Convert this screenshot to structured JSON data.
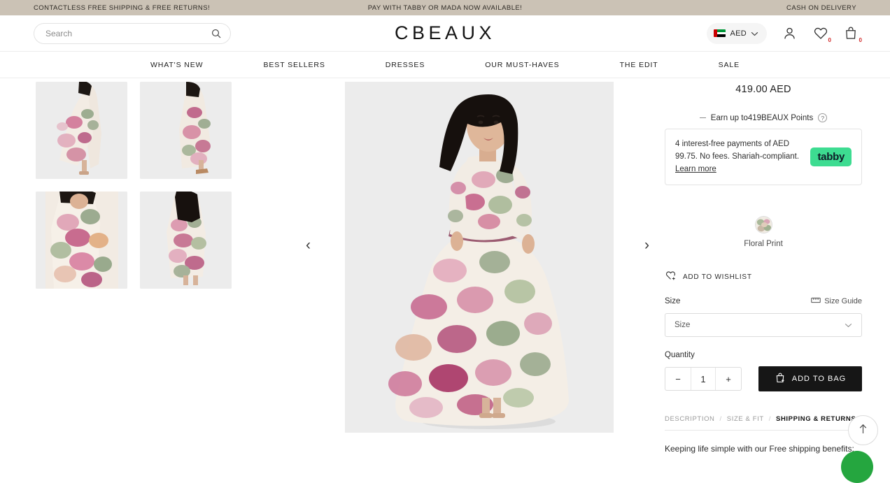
{
  "announcement": {
    "left": "CONTACTLESS FREE SHIPPING & FREE RETURNS!",
    "center": "PAY WITH TABBY OR MADA NOW AVAILABLE!",
    "right": "CASH ON DELIVERY",
    "background": "#cbc2b5"
  },
  "header": {
    "logo": "CBEAUX",
    "search_placeholder": "Search",
    "search_value": "",
    "currency": "AED",
    "wishlist_count": "0",
    "bag_count": "0"
  },
  "nav": {
    "items": [
      {
        "label": "WHAT'S NEW"
      },
      {
        "label": "BEST SELLERS"
      },
      {
        "label": "DRESSES"
      },
      {
        "label": "OUR MUST-HAVES"
      },
      {
        "label": "THE EDIT"
      },
      {
        "label": "SALE"
      }
    ]
  },
  "gallery": {
    "prev_arrow": "‹",
    "next_arrow": "›",
    "thumbnails": [
      {
        "alt": "floral maxi dress side flowing view"
      },
      {
        "alt": "floral maxi dress side profile view"
      },
      {
        "alt": "floral maxi dress bodice close-up"
      },
      {
        "alt": "floral maxi dress back view"
      }
    ],
    "hero": {
      "alt": "model wearing floral print maxi dress front view"
    }
  },
  "product": {
    "price": "419.00 AED",
    "points_text": "Earn up to419BEAUX Points",
    "points_help": "?",
    "tabby": {
      "text": "4 interest-free payments of AED 99.75. No fees. Shariah-compliant. ",
      "link": "Learn more",
      "logo": "tabby",
      "logo_color": "#3ddc91"
    },
    "color": {
      "name": "Floral Print"
    },
    "wishlist_label": "ADD TO WISHLIST",
    "size_label": "Size",
    "size_guide_label": "Size Guide",
    "size_selected": "Size",
    "quantity_label": "Quantity",
    "quantity_value": "1",
    "decrement": "−",
    "increment": "+",
    "add_to_bag": "ADD TO BAG",
    "tabs": [
      {
        "label": "DESCRIPTION",
        "active": false
      },
      {
        "label": "SIZE & FIT",
        "active": false
      },
      {
        "label": "SHIPPING & RETURNS",
        "active": true
      }
    ],
    "tab_separator": "/",
    "tab_body": "Keeping life simple with our Free shipping benefits:"
  },
  "floating": {
    "scroll_top_icon": "↑",
    "whatsapp_color": "#25a63f"
  }
}
